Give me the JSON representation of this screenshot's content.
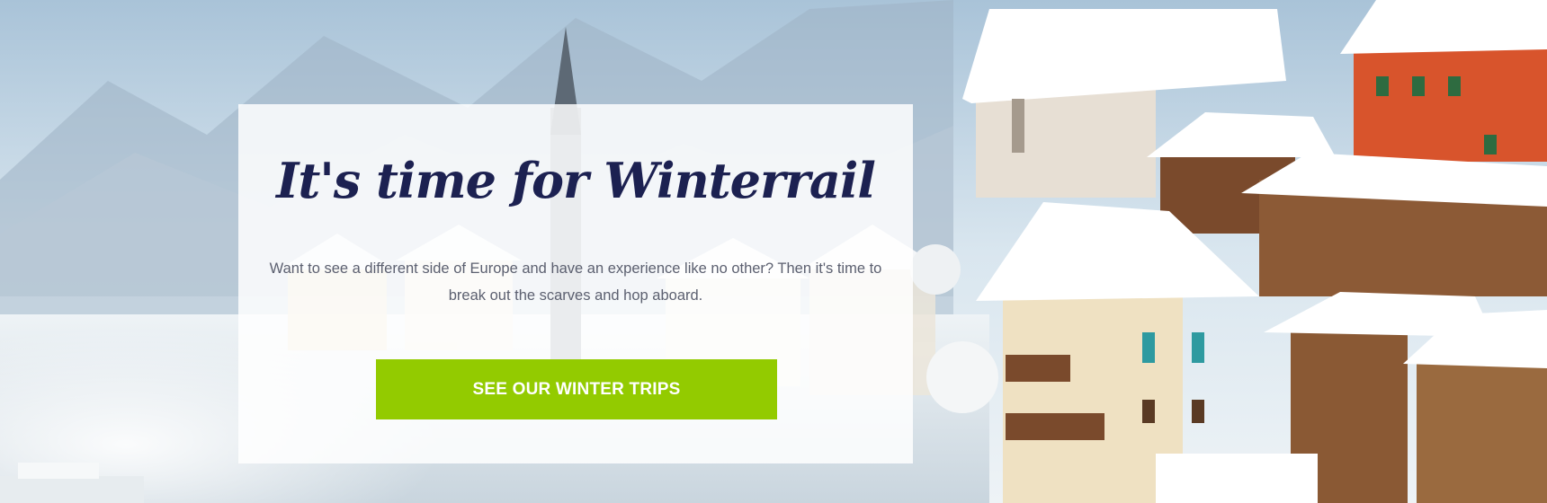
{
  "hero": {
    "title": "It's time for Winterrail",
    "description": "Want to see a different side of Europe and have an experience like no other? Then it's time to break out the scarves and hop aboard.",
    "cta_label": "SEE OUR WINTER TRIPS",
    "colors": {
      "title": "#1c2151",
      "text": "#5c6070",
      "cta_background": "#93cb00",
      "cta_text": "#ffffff"
    }
  }
}
